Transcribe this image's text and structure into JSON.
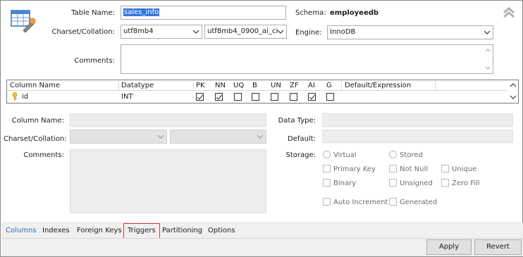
{
  "header": {
    "table_name_label": "Table Name:",
    "table_name_value": "sales_info",
    "schema_label": "Schema:",
    "schema_value": "employeedb",
    "charset_label": "Charset/Collation:",
    "charset_value": "utf8mb4",
    "collation_value": "utf8mb4_0900_ai_ci",
    "engine_label": "Engine:",
    "engine_value": "InnoDB",
    "comments_label": "Comments:",
    "comments_value": ""
  },
  "columns_grid": {
    "headers": [
      "Column Name",
      "Datatype",
      "PK",
      "NN",
      "UQ",
      "B",
      "UN",
      "ZF",
      "AI",
      "G",
      "Default/Expression"
    ],
    "rows": [
      {
        "name": "id",
        "datatype": "INT",
        "pk": true,
        "nn": true,
        "uq": false,
        "b": false,
        "un": false,
        "zf": false,
        "ai": true,
        "g": false,
        "default": "",
        "key_icon": "primary-key-icon"
      }
    ]
  },
  "details": {
    "column_name_label": "Column Name:",
    "charset_label": "Charset/Collation:",
    "comments_label": "Comments:",
    "data_type_label": "Data Type:",
    "default_label": "Default:",
    "storage_label": "Storage:",
    "storage_options": [
      "Virtual",
      "Stored"
    ],
    "flags": [
      "Primary Key",
      "Not Null",
      "Unique",
      "Binary",
      "Unsigned",
      "Zero Fill",
      "Auto Increment",
      "Generated"
    ]
  },
  "tabs": {
    "items": [
      "Columns",
      "Indexes",
      "Foreign Keys",
      "Triggers",
      "Partitioning",
      "Options"
    ],
    "active": "Columns",
    "highlighted": "Triggers"
  },
  "footer": {
    "apply_label": "Apply",
    "revert_label": "Revert"
  },
  "colors": {
    "tab_active": "#2b6cb0",
    "highlight_box": "#d9363e",
    "selection": "#3377dd"
  }
}
